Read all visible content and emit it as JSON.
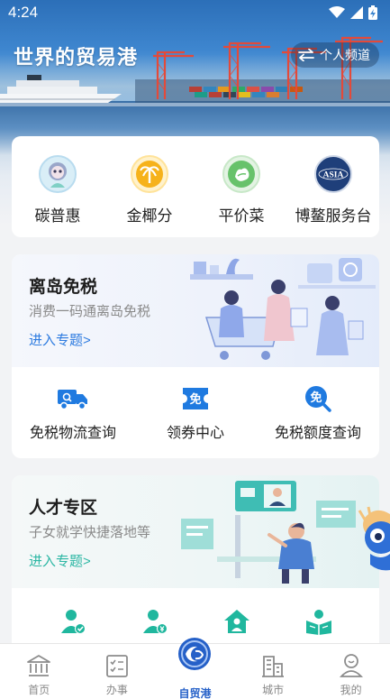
{
  "status": {
    "time": "4:24"
  },
  "header": {
    "title": "世界的贸易港",
    "channel_label": "个人频道"
  },
  "quick_services": [
    {
      "label": "碳普惠",
      "icon": "carbon-avatar-icon"
    },
    {
      "label": "金椰分",
      "icon": "golden-coconut-icon"
    },
    {
      "label": "平价菜",
      "icon": "vegetable-icon"
    },
    {
      "label": "博鳌服务台",
      "icon": "boao-asia-icon",
      "badge": "ASIA"
    }
  ],
  "duty_free": {
    "title": "离岛免税",
    "subtitle": "消费一码通离岛免税",
    "link": "进入专题>",
    "items": [
      {
        "label": "免税物流查询",
        "icon": "logistics-truck-icon"
      },
      {
        "label": "领券中心",
        "icon": "coupon-icon",
        "glyph": "免"
      },
      {
        "label": "免税额度查询",
        "icon": "quota-search-icon",
        "glyph": "免"
      }
    ]
  },
  "talent": {
    "title": "人才专区",
    "subtitle": "子女就学快捷落地等",
    "link": "进入专题>",
    "icons": [
      "person-check-icon",
      "person-money-icon",
      "house-person-icon",
      "reading-book-icon"
    ]
  },
  "tabbar": [
    {
      "label": "首页",
      "icon": "bank-icon"
    },
    {
      "label": "办事",
      "icon": "checklist-icon"
    },
    {
      "label": "自贸港",
      "icon": "free-trade-port-logo-icon",
      "active": true
    },
    {
      "label": "城市",
      "icon": "city-buildings-icon"
    },
    {
      "label": "我的",
      "icon": "user-icon"
    }
  ],
  "colors": {
    "accent_blue": "#2560c8",
    "link_blue": "#2d7be0",
    "talent_teal": "#2cb7a4",
    "icon_blue": "#1f7ae0"
  }
}
